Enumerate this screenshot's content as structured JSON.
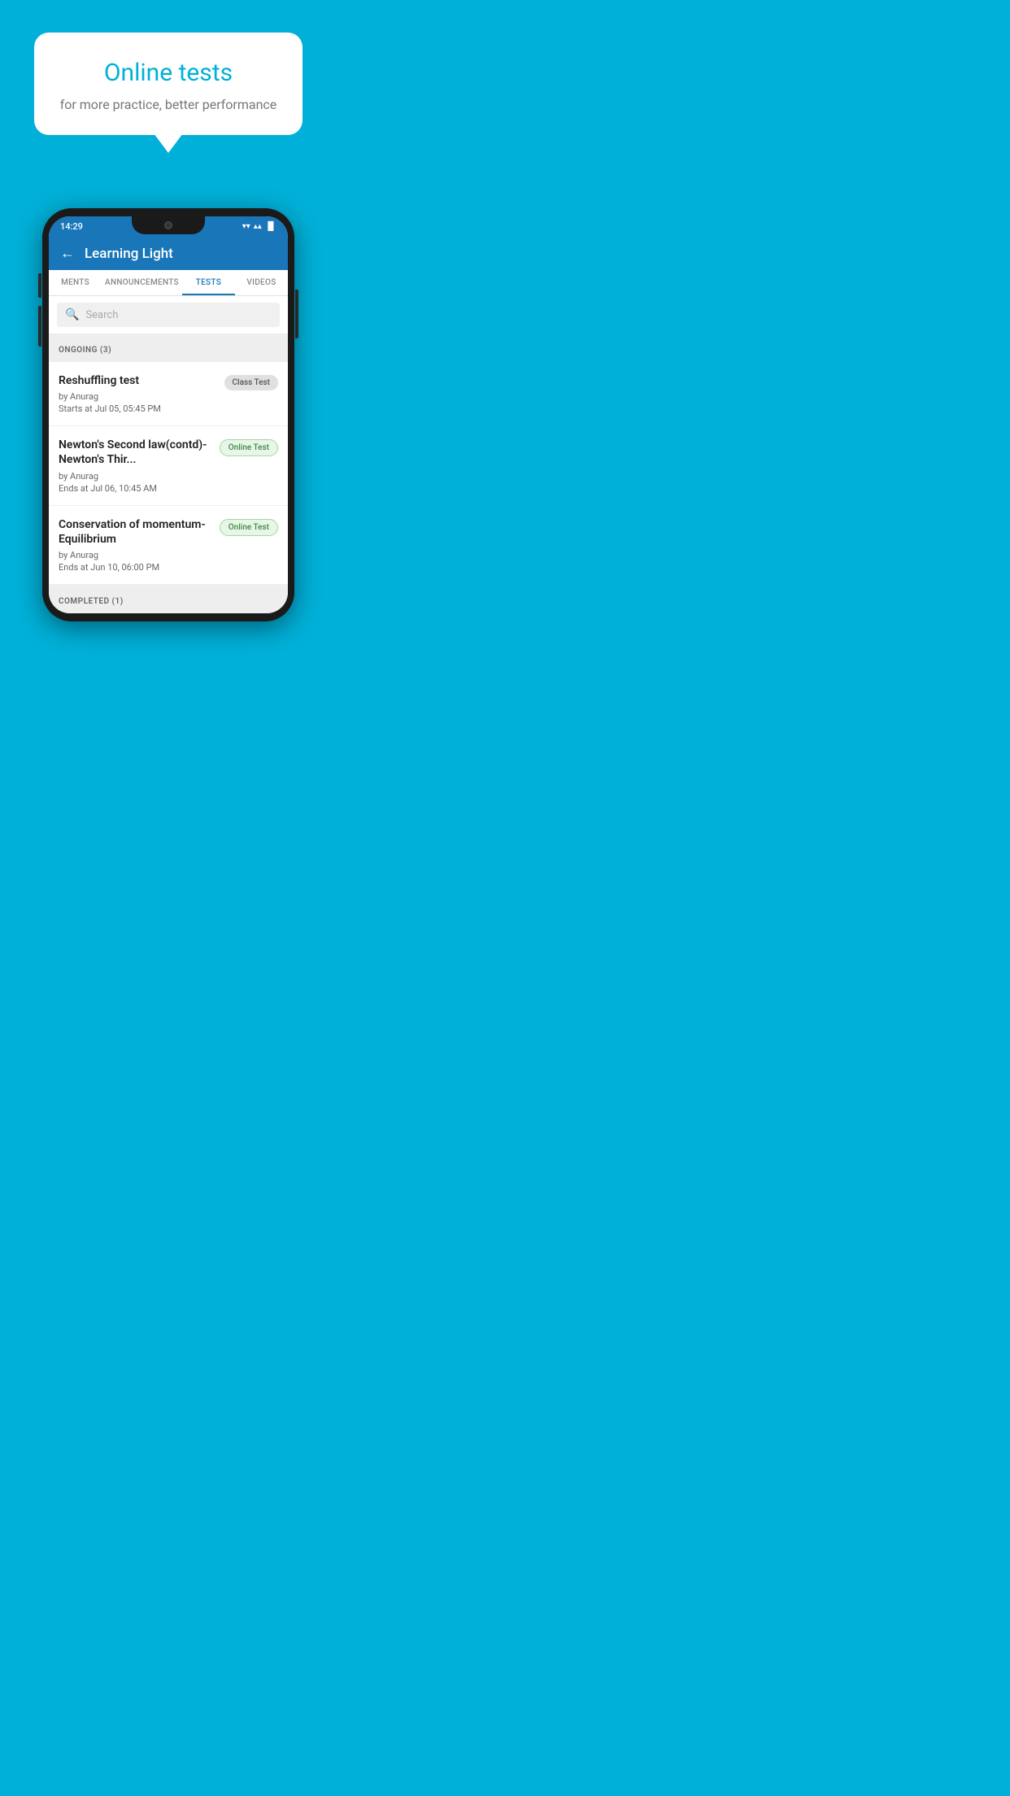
{
  "background_color": "#00B0D8",
  "promo": {
    "title": "Online tests",
    "subtitle": "for more practice, better performance"
  },
  "status_bar": {
    "time": "14:29",
    "wifi": "▾",
    "signal": "▴▴",
    "battery": "▐"
  },
  "app_bar": {
    "back_label": "←",
    "title": "Learning Light"
  },
  "tabs": [
    {
      "label": "MENTS",
      "active": false
    },
    {
      "label": "ANNOUNCEMENTS",
      "active": false
    },
    {
      "label": "TESTS",
      "active": true
    },
    {
      "label": "VIDEOS",
      "active": false
    }
  ],
  "search": {
    "placeholder": "Search",
    "icon": "🔍"
  },
  "ongoing_section": {
    "label": "ONGOING (3)"
  },
  "tests": [
    {
      "name": "Reshuffling test",
      "by": "by Anurag",
      "date_label": "Starts at",
      "date": "Jul 05, 05:45 PM",
      "badge": "Class Test",
      "badge_type": "class"
    },
    {
      "name": "Newton's Second law(contd)-Newton's Thir...",
      "by": "by Anurag",
      "date_label": "Ends at",
      "date": "Jul 06, 10:45 AM",
      "badge": "Online Test",
      "badge_type": "online"
    },
    {
      "name": "Conservation of momentum-Equilibrium",
      "by": "by Anurag",
      "date_label": "Ends at",
      "date": "Jun 10, 06:00 PM",
      "badge": "Online Test",
      "badge_type": "online"
    }
  ],
  "completed_section": {
    "label": "COMPLETED (1)"
  }
}
